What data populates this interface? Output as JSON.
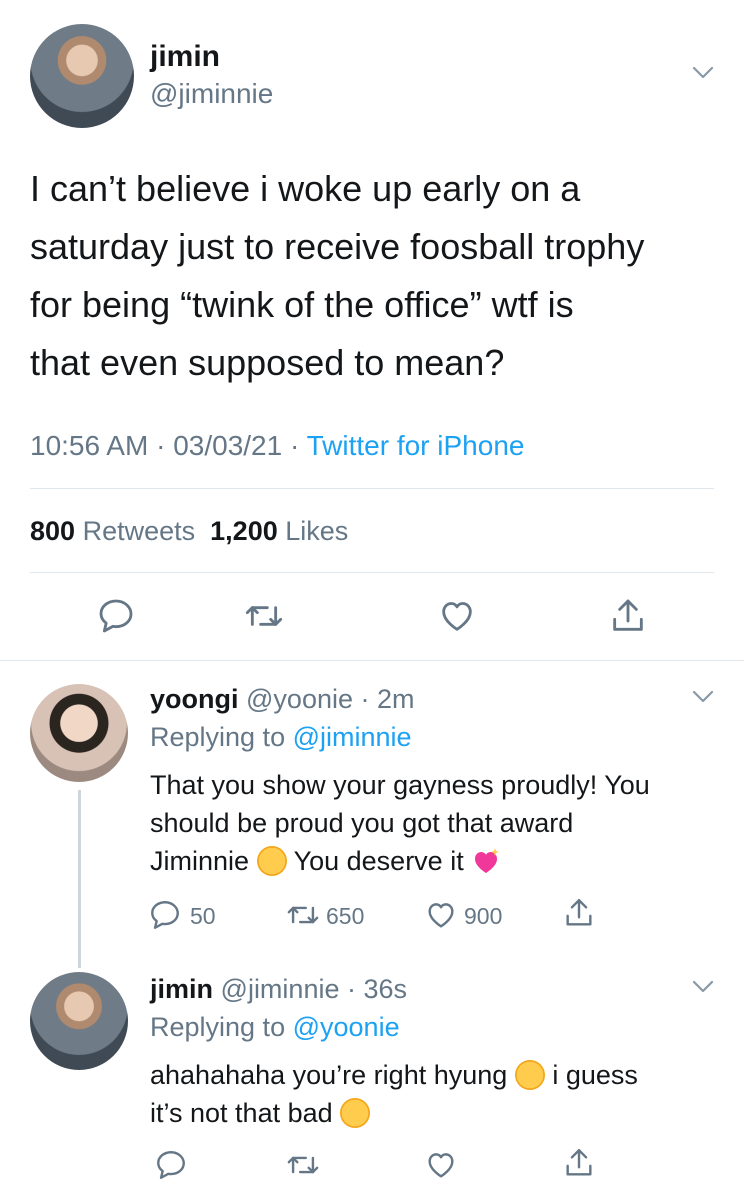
{
  "main_tweet": {
    "name": "jimin",
    "handle": "@jiminnie",
    "text_lines": [
      "I can’t believe i woke up early on a",
      "saturday just to receive foosball trophy",
      "for being “twink of the office” wtf is",
      "that even supposed to mean?"
    ],
    "time": "10:56 AM",
    "date": "03/03/21",
    "source": "Twitter for iPhone",
    "retweets_count": "800",
    "retweets_label": "Retweets",
    "likes_count": "1,200",
    "likes_label": "Likes"
  },
  "reply1": {
    "name": "yoongi",
    "handle": "@yoonie",
    "age": "2m",
    "replying_label": "Replying to",
    "replying_to": "@jiminnie",
    "line1": "That you show your gayness proudly! You",
    "line2": "should be proud you got that award",
    "line3a": "Jiminnie",
    "line3b": "You deserve it",
    "replies": "50",
    "retweets": "650",
    "likes": "900"
  },
  "reply2": {
    "name": "jimin",
    "handle": "@jiminnie",
    "age": "36s",
    "replying_label": "Replying to",
    "replying_to": "@yoonie",
    "line1a": "ahahahaha you’re right hyung",
    "line1b": "i guess",
    "line2": "it’s not that bad"
  },
  "icons": [
    "reply-icon",
    "retweet-icon",
    "like-icon",
    "share-icon",
    "chevron-down-icon"
  ],
  "colors": {
    "link": "#1da1f2",
    "secondary_text": "#657786",
    "divider": "#e1e8ed"
  }
}
